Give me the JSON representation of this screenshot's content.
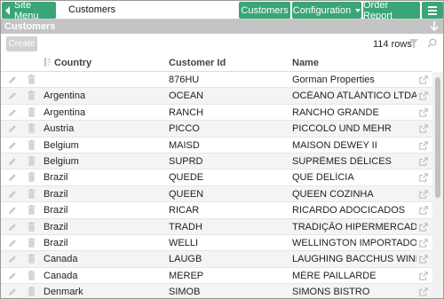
{
  "topbar": {
    "site_menu": "Site Menu",
    "page_title": "Customers",
    "nav": {
      "customers": "Customers",
      "configuration": "Configuration",
      "order_report": "Order Report"
    }
  },
  "panel": {
    "title": "Customers"
  },
  "toolbar": {
    "create": "Create",
    "row_count": "114 rows"
  },
  "columns": {
    "country": "Country",
    "customer_id": "Customer Id",
    "name": "Name"
  },
  "rows": [
    {
      "country": "",
      "customer_id": "876HU",
      "name": "Gorman Properties"
    },
    {
      "country": "Argentina",
      "customer_id": "OCEAN",
      "name": "OCÉANO ATLÁNTICO LTDA."
    },
    {
      "country": "Argentina",
      "customer_id": "RANCH",
      "name": "RANCHO GRANDE"
    },
    {
      "country": "Austria",
      "customer_id": "PICCO",
      "name": "PICCOLO UND MEHR"
    },
    {
      "country": "Belgium",
      "customer_id": "MAISD",
      "name": "MAISON DEWEY II"
    },
    {
      "country": "Belgium",
      "customer_id": "SUPRD",
      "name": "SUPRÊMES DÉLICES"
    },
    {
      "country": "Brazil",
      "customer_id": "QUEDE",
      "name": "QUE DELÍCIA"
    },
    {
      "country": "Brazil",
      "customer_id": "QUEEN",
      "name": "QUEEN COZINHA"
    },
    {
      "country": "Brazil",
      "customer_id": "RICAR",
      "name": "RICARDO ADOCICADOS"
    },
    {
      "country": "Brazil",
      "customer_id": "TRADH",
      "name": "TRADIÇÃO HIPERMERCADOS"
    },
    {
      "country": "Brazil",
      "customer_id": "WELLI",
      "name": "WELLINGTON IMPORTADORA"
    },
    {
      "country": "Canada",
      "customer_id": "LAUGB",
      "name": "LAUGHING BACCHUS WINE ..."
    },
    {
      "country": "Canada",
      "customer_id": "MEREP",
      "name": "MÈRE PAILLARDE"
    },
    {
      "country": "Denmark",
      "customer_id": "SIMOB",
      "name": "SIMONS BISTRO"
    }
  ],
  "colors": {
    "accent": "#3aa576",
    "panel_bar": "#c4c4c4"
  }
}
